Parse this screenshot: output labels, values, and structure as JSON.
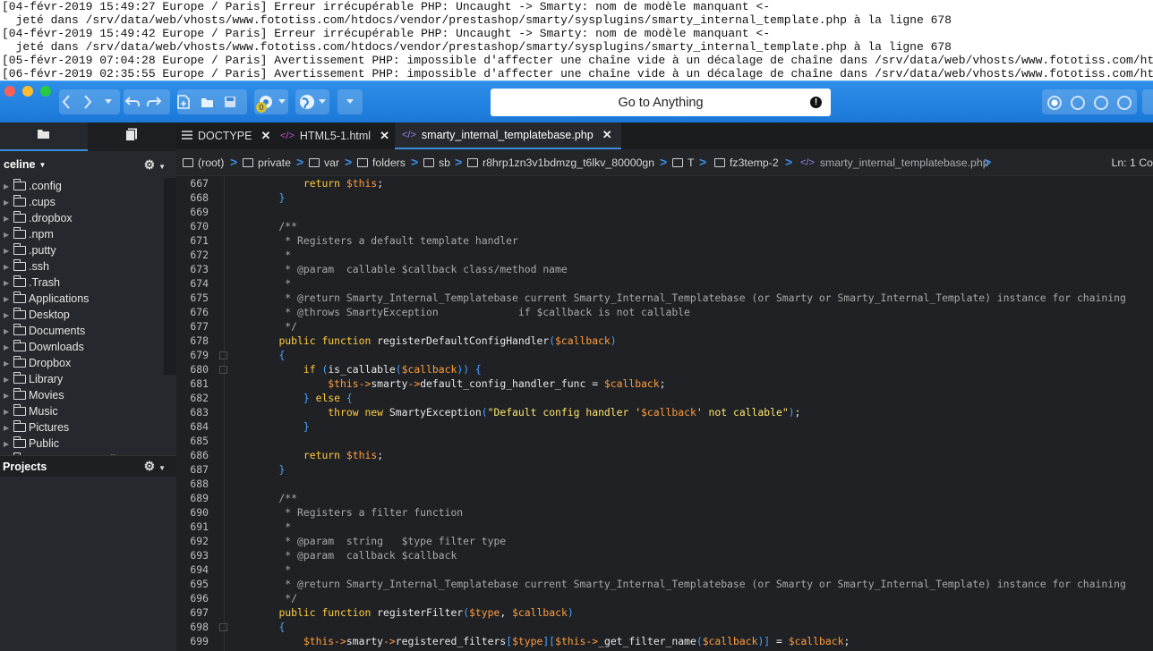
{
  "log": {
    "lines": [
      "[04-févr-2019 15:49:27 Europe / Paris] Erreur irrécupérable PHP: Uncaught -> Smarty: nom de modèle manquant <-",
      "  jeté dans /srv/data/web/vhosts/www.fototiss.com/htdocs/vendor/prestashop/smarty/sysplugins/smarty_internal_template.php à la ligne 678",
      "[04-févr-2019 15:49:42 Europe / Paris] Erreur irrécupérable PHP: Uncaught -> Smarty: nom de modèle manquant <-",
      "  jeté dans /srv/data/web/vhosts/www.fototiss.com/htdocs/vendor/prestashop/smarty/sysplugins/smarty_internal_template.php à la ligne 678",
      "[05-févr-2019 07:04:28 Europe / Paris] Avertissement PHP: impossible d'affecter une chaîne vide à un décalage de chaîne dans /srv/data/web/vhosts/www.fototiss.com/ht",
      "[06-févr-2019 02:35:55 Europe / Paris] Avertissement PHP: impossible d'affecter une chaîne vide à un décalage de chaîne dans /srv/data/web/vhosts/www.fototiss.com/ht"
    ]
  },
  "toolbar": {
    "goto_label": "Go to Anything",
    "badge_count": "0",
    "colors": {
      "accent": "#1f7fde",
      "close": "#fe5f57",
      "minimize": "#febc2e",
      "zoom": "#28c840"
    }
  },
  "sidebar": {
    "user": "celine",
    "items": [
      ".config",
      ".cups",
      ".dropbox",
      ".npm",
      ".putty",
      ".ssh",
      ".Trash",
      "Applications",
      "Desktop",
      "Documents",
      "Downloads",
      "Dropbox",
      "Library",
      "Movies",
      "Music",
      "Pictures",
      "Public",
      "SFU - TextEncoding"
    ],
    "projects_label": "Projects"
  },
  "tabs": [
    {
      "label": "DOCTYPE"
    },
    {
      "label": "HTML5-1.html"
    },
    {
      "label": "smarty_internal_templatebase.php"
    }
  ],
  "breadcrumb": {
    "parts": [
      "(root)",
      "private",
      "var",
      "folders",
      "sb",
      "r8hrp1zn3v1bdmzg_t6lkv_80000gn",
      "T",
      "fz3temp-2",
      "smarty_internal_templatebase.php"
    ],
    "position": "Ln: 1 Co"
  },
  "code": {
    "lines": [
      {
        "n": "667",
        "t": "        return $this;"
      },
      {
        "n": "668",
        "t": "    }"
      },
      {
        "n": "669",
        "t": ""
      },
      {
        "n": "670",
        "t": "    /**"
      },
      {
        "n": "671",
        "t": "     * Registers a default template handler"
      },
      {
        "n": "672",
        "t": "     *"
      },
      {
        "n": "673",
        "t": "     * @param  callable $callback class/method name"
      },
      {
        "n": "674",
        "t": "     *"
      },
      {
        "n": "675",
        "t": "     * @return Smarty_Internal_Templatebase current Smarty_Internal_Templatebase (or Smarty or Smarty_Internal_Template) instance for chaining"
      },
      {
        "n": "676",
        "t": "     * @throws SmartyException             if $callback is not callable"
      },
      {
        "n": "677",
        "t": "     */"
      },
      {
        "n": "678",
        "t": "    public function registerDefaultConfigHandler($callback)"
      },
      {
        "n": "679",
        "t": "    {"
      },
      {
        "n": "680",
        "t": "        if (is_callable($callback)) {"
      },
      {
        "n": "681",
        "t": "            $this->smarty->default_config_handler_func = $callback;"
      },
      {
        "n": "682",
        "t": "        } else {"
      },
      {
        "n": "683",
        "t": "            throw new SmartyException(\"Default config handler '$callback' not callable\");"
      },
      {
        "n": "684",
        "t": "        }"
      },
      {
        "n": "685",
        "t": ""
      },
      {
        "n": "686",
        "t": "        return $this;"
      },
      {
        "n": "687",
        "t": "    }"
      },
      {
        "n": "688",
        "t": ""
      },
      {
        "n": "689",
        "t": "    /**"
      },
      {
        "n": "690",
        "t": "     * Registers a filter function"
      },
      {
        "n": "691",
        "t": "     *"
      },
      {
        "n": "692",
        "t": "     * @param  string   $type filter type"
      },
      {
        "n": "693",
        "t": "     * @param  callback $callback"
      },
      {
        "n": "694",
        "t": "     *"
      },
      {
        "n": "695",
        "t": "     * @return Smarty_Internal_Templatebase current Smarty_Internal_Templatebase (or Smarty or Smarty_Internal_Template) instance for chaining"
      },
      {
        "n": "696",
        "t": "     */"
      },
      {
        "n": "697",
        "t": "    public function registerFilter($type, $callback)"
      },
      {
        "n": "698",
        "t": "    {"
      },
      {
        "n": "699",
        "t": "        $this->smarty->registered_filters[$type][$this->_get_filter_name($callback)] = $callback;"
      }
    ]
  }
}
